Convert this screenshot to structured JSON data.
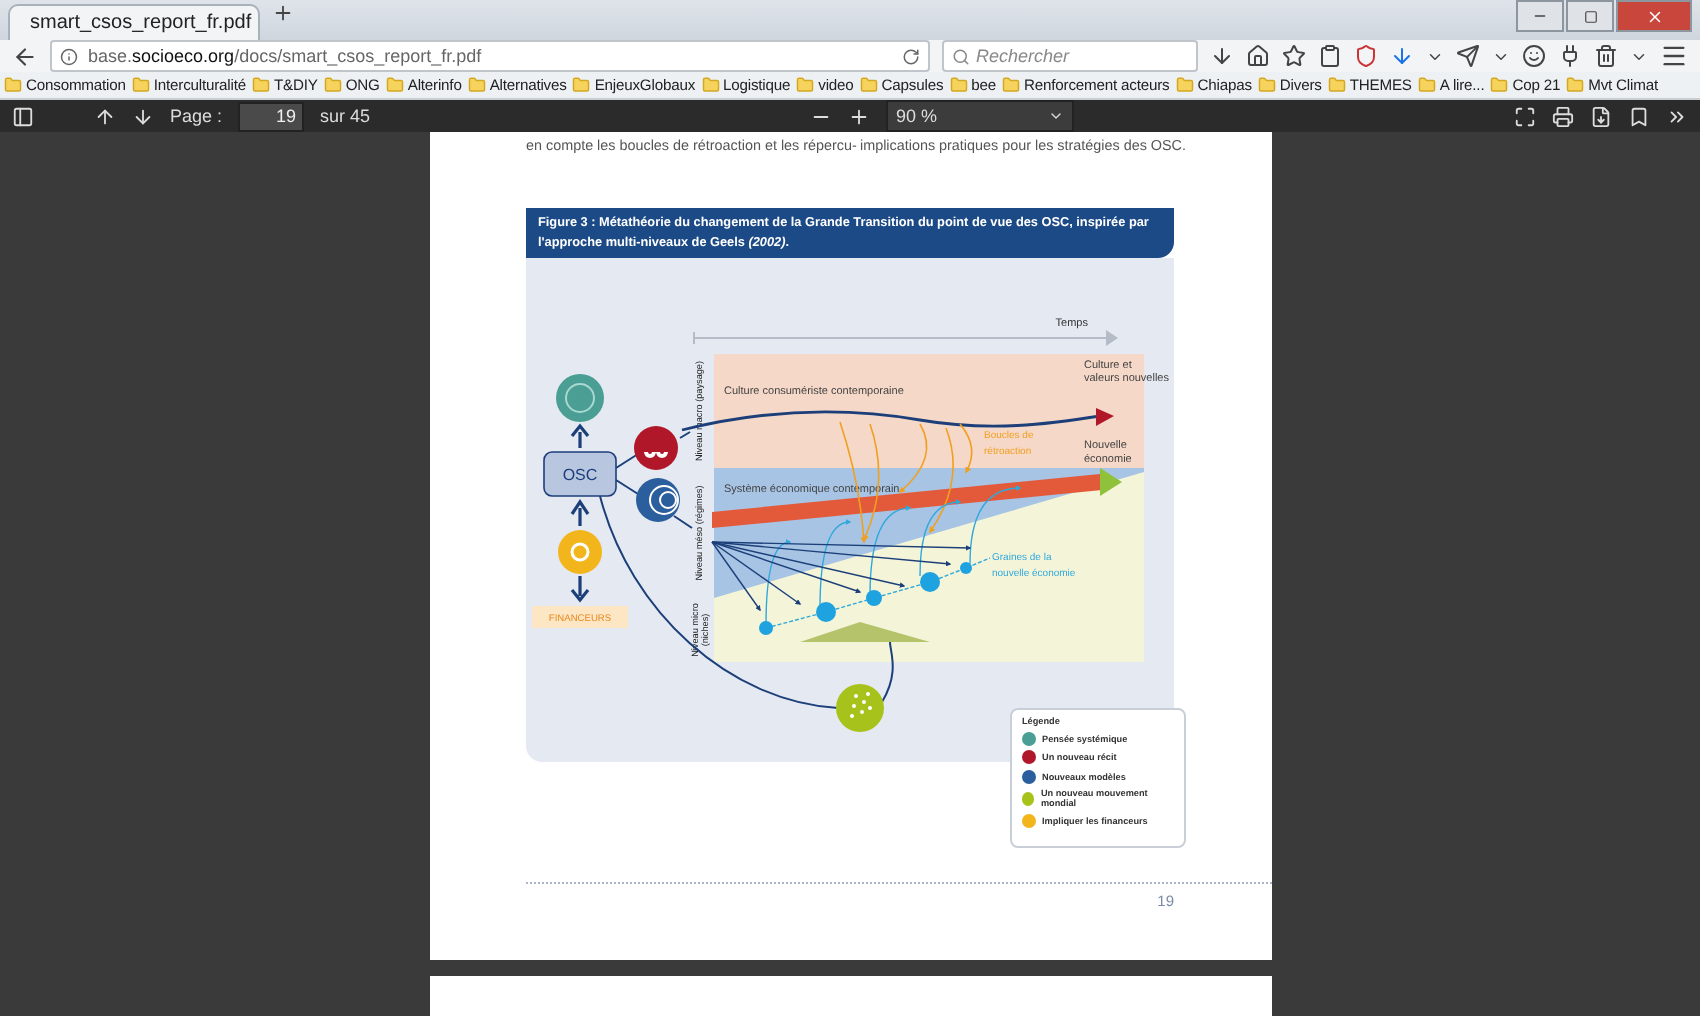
{
  "tab": {
    "title": "smart_csos_report_fr.pdf",
    "selected": true
  },
  "address": {
    "url": "base.**socioeco.org**/docs/smart_csos_report_fr.pdf"
  },
  "search": {
    "placeholder": "Rechercher"
  },
  "bookmarks": [
    "Consommation",
    "Interculturalité",
    "T&DIY",
    "ONG",
    "Alterinfo",
    "Alternatives",
    "EnjeuxGlobaux",
    "Logistique",
    "video",
    "Capsules",
    "bee",
    "Renforcement acteurs",
    "Chiapas",
    "Divers",
    "THEMES",
    "A lire...",
    "Cop 21",
    "Mvt Climat"
  ],
  "pdf_toolbar": {
    "page_label": "Page :",
    "page": "19",
    "total": "sur 45",
    "zoom": "90 %"
  },
  "page": {
    "columns": [
      "en compte les boucles de rétroaction et les répercu-",
      "implications pratiques pour les stratégies des OSC."
    ],
    "figure": {
      "caption": "Figure 3 : Métathéorie du changement de la Grande Transition du point de vue des OSC, inspirée par l'approche multi-niveaux de Geels *(2002)*.",
      "time_axis": "Temps",
      "levels": [
        "Niveau macro (paysage)",
        "Niveau méso (régimes)",
        "Niveau micro (niches)"
      ],
      "labels": {
        "culture": "Culture consumériste contemporaine",
        "new_culture": "Culture et valeurs nouvelles",
        "loops": "Boucles de rétroaction",
        "new_economy": "Nouvelle économie",
        "system": "Système économique contemporain",
        "seeds": "Graines de la nouvelle économie"
      },
      "actor": "OSC",
      "funders": "FINANCEURS"
    },
    "legend": {
      "title": "Légende",
      "items": [
        {
          "label": "Pensée systémique",
          "color": "#4a9e94"
        },
        {
          "label": "Un nouveau récit",
          "color": "#b0182a"
        },
        {
          "label": "Nouveaux modèles",
          "color": "#2b5e9c"
        },
        {
          "label": "Un nouveau mouvement mondial",
          "color": "#a8c21c"
        },
        {
          "label": "Impliquer les financeurs",
          "color": "#f2b51c"
        }
      ]
    },
    "page_number": "19"
  }
}
